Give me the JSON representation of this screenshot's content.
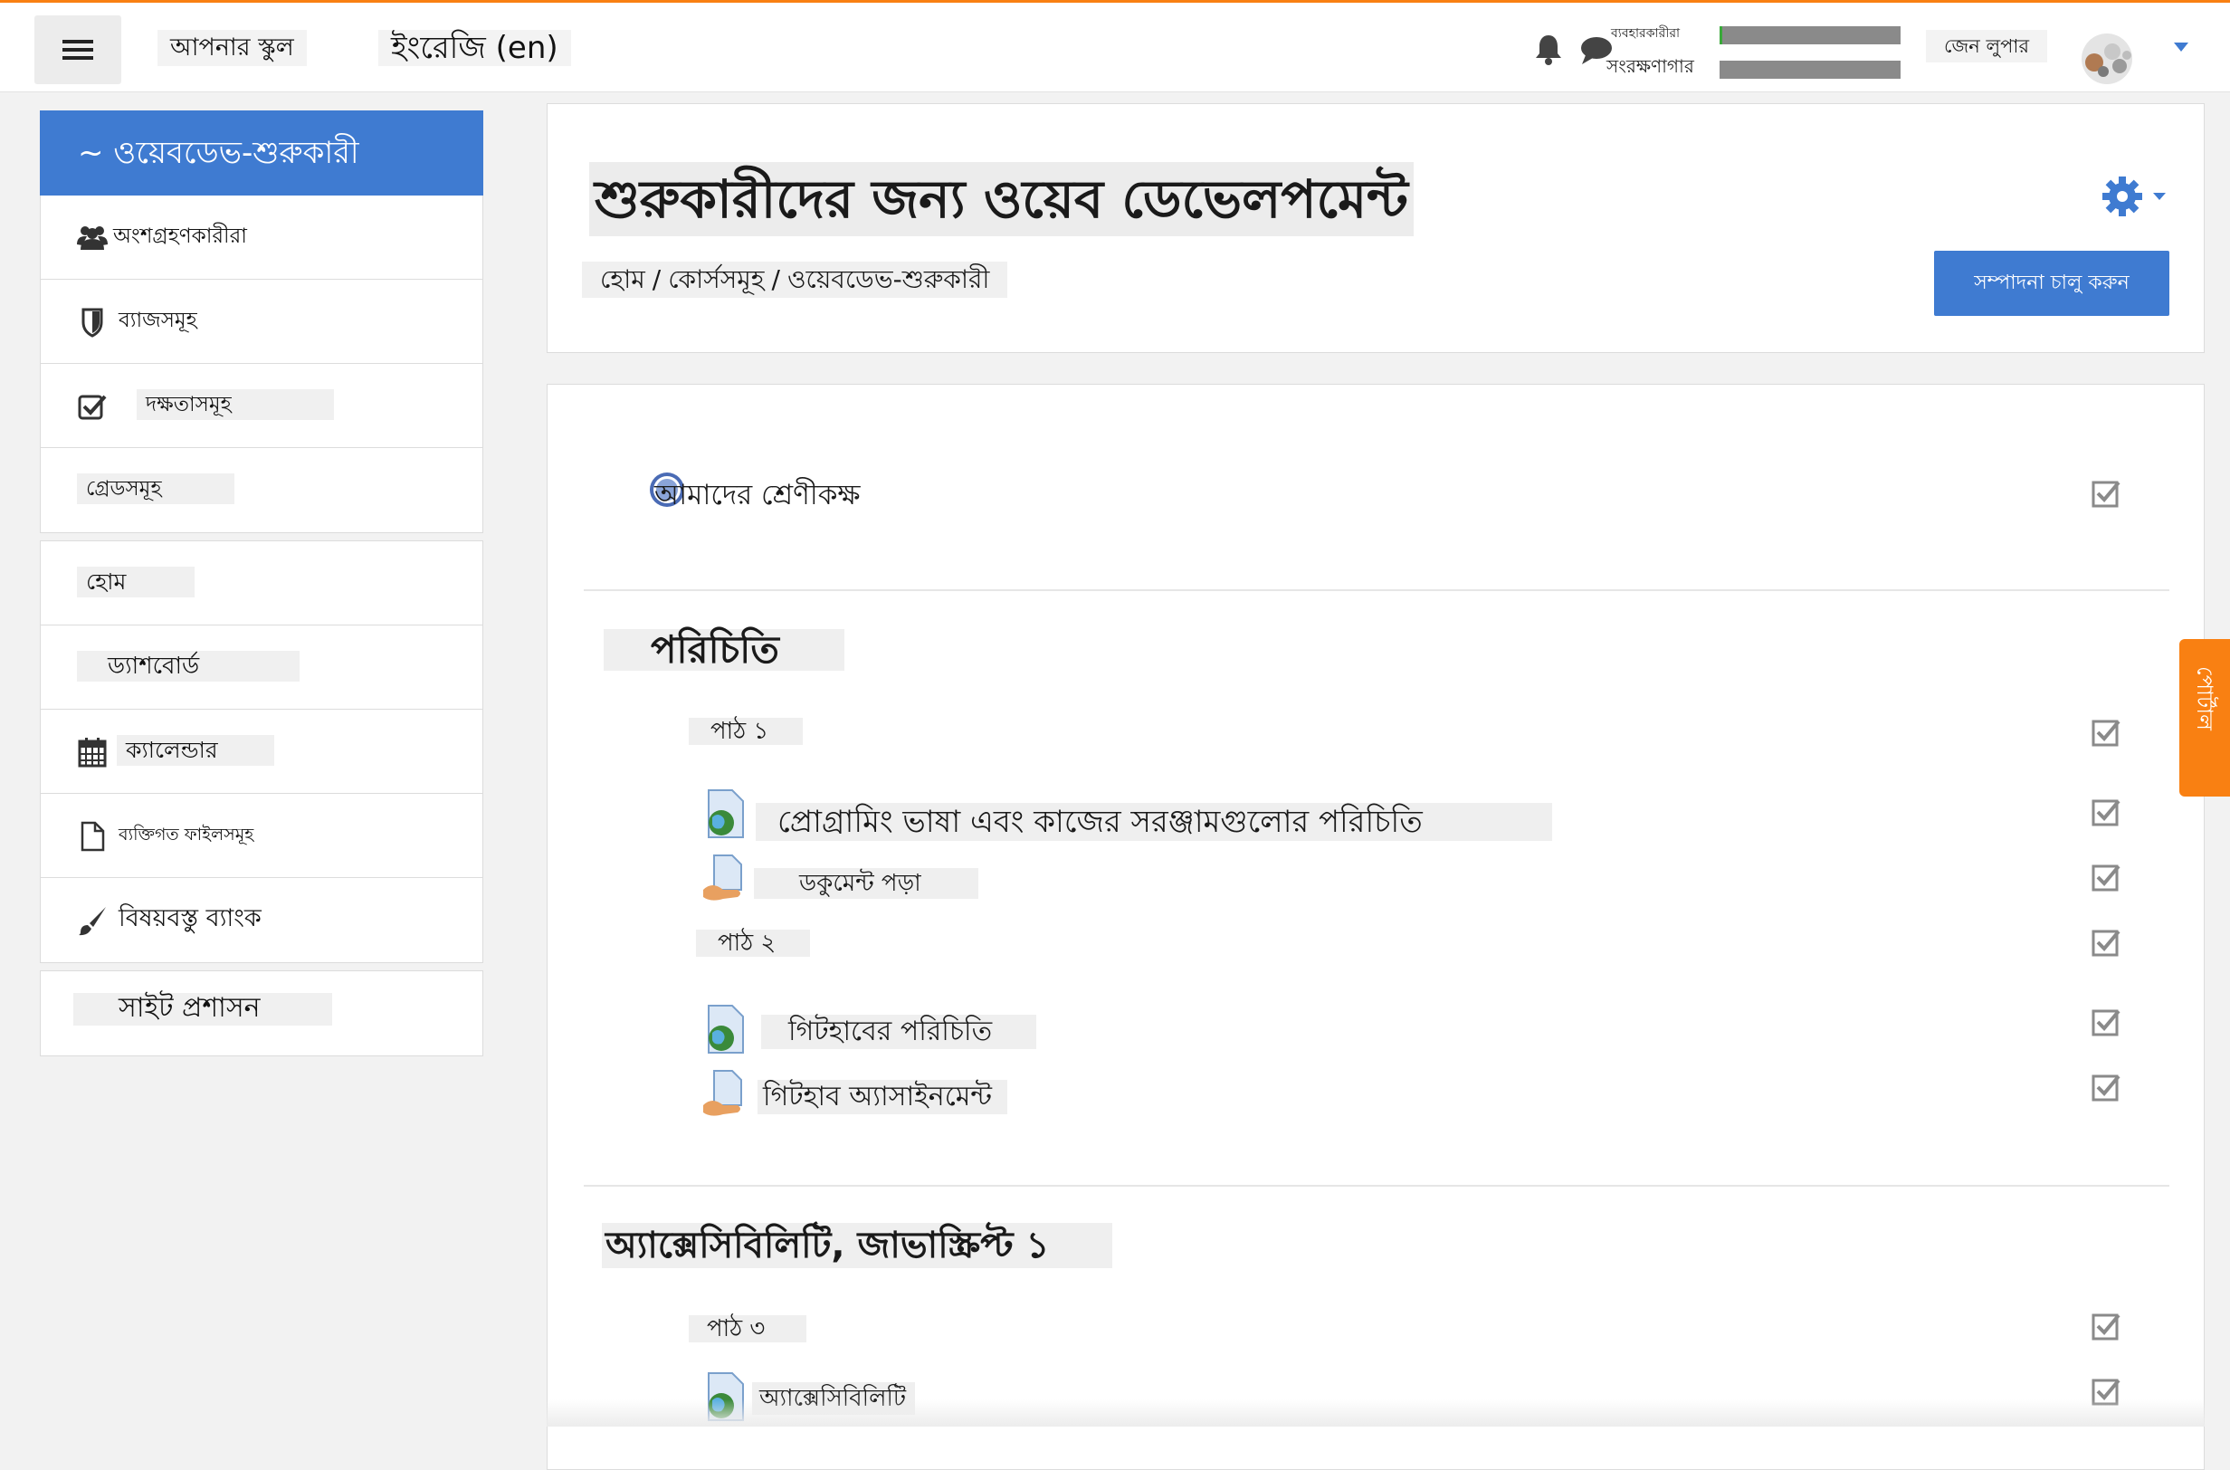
{
  "topbar": {
    "site_name": "আপনার স্কুল",
    "language": "ইংরেজি (en)",
    "role_small": "ব্যবহারকারীরা",
    "role_main": "সংরক্ষণাগার",
    "user_name": "জেন লুপার",
    "icons": {
      "menu": "hamburger-icon",
      "notifications": "bell-icon",
      "messages": "chat-icon",
      "user_menu": "caret-down-icon"
    },
    "accent_color": "#f98012"
  },
  "sidebar": {
    "course_item": "~ ওয়েবডেভ-শুরুকারী",
    "course_items": [
      {
        "label": "অংশগ্রহণকারীরা",
        "icon": "users-icon"
      },
      {
        "label": "ব্যাজসমূহ",
        "icon": "shield-icon"
      },
      {
        "label": "দক্ষতাসমূহ",
        "icon": "checkbox-icon"
      },
      {
        "label": "গ্রেডসমূহ",
        "icon": ""
      }
    ],
    "site_items": [
      {
        "label": "হোম",
        "icon": ""
      },
      {
        "label": "ড্যাশবোর্ড",
        "icon": ""
      },
      {
        "label": "ক্যালেন্ডার",
        "icon": "calendar-icon"
      },
      {
        "label": "ব্যক্তিগত ফাইলসমূহ",
        "icon": "file-icon"
      },
      {
        "label": "বিষয়বস্তু ব্যাংক",
        "icon": "paintbrush-icon"
      }
    ],
    "admin_item": "সাইট প্রশাসন",
    "active_color": "#3f7bd1"
  },
  "header": {
    "course_title": "শুরুকারীদের জন্য ওয়েব ডেভেলপমেন্ট",
    "breadcrumb": [
      "হোম",
      "কোর্সসমূহ",
      "ওয়েবডেভ-শুরুকারী"
    ],
    "breadcrumb_separator": "/",
    "edit_button": "সম্পাদনা চালু করুন",
    "settings_icon": "gear-icon"
  },
  "content": {
    "forum": {
      "label": "আমাদের শ্রেণীকক্ষ",
      "icon": "forum-icon"
    },
    "sections": [
      {
        "title": "পরিচিতি",
        "lessons": [
          {
            "label": "পাঠ ১",
            "activities": [
              {
                "label": "প্রোগ্রামিং ভাষা এবং কাজের সরঞ্জামগুলোর পরিচিতি",
                "icon": "url-globe-icon"
              },
              {
                "label": "ডকুমেন্ট পড়া",
                "icon": "assignment-hand-icon"
              }
            ]
          },
          {
            "label": "পাঠ ২",
            "activities": [
              {
                "label": "গিটহাবের পরিচিতি",
                "icon": "url-globe-icon"
              },
              {
                "label": "গিটহাব অ্যাসাইনমেন্ট",
                "icon": "assignment-hand-icon"
              }
            ]
          }
        ]
      },
      {
        "title": "অ্যাক্সেসিবিলিটি, জাভাস্ক্রিপ্ট ১",
        "lessons": [
          {
            "label": "পাঠ ৩",
            "activities": [
              {
                "label": "অ্যাক্সেসিবিলিটি",
                "icon": "url-globe-icon"
              }
            ]
          }
        ]
      }
    ],
    "completion_icon": "completion-checkbox-icon"
  },
  "blocks_drawer": {
    "label": "পোর্টাল",
    "color": "#f98012"
  }
}
